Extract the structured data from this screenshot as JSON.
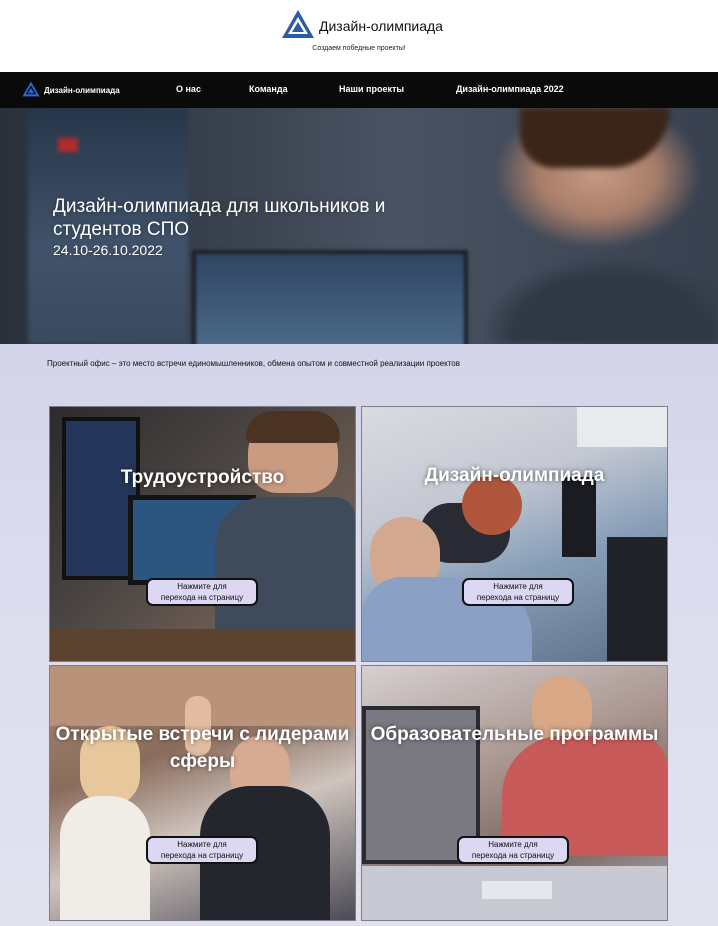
{
  "header": {
    "brand_title": "Дизайн-олимпиада",
    "tagline": "Создаем победные проекты!"
  },
  "nav": {
    "logo_label": "Дизайн-олимпиада",
    "links": [
      "О нас",
      "Команда",
      "Наши проекты",
      "Дизайн-олимпиада 2022"
    ]
  },
  "hero": {
    "title": "Дизайн-олимпиада для школьников и студентов СПО",
    "dates": "24.10-26.10.2022"
  },
  "intro": {
    "text": "Проектный офис – это место встречи единомышленников, обмена опытом и совместной реализации проектов"
  },
  "cards": [
    {
      "title": "Трудоустройство",
      "button_line1": "Нажмите для",
      "button_line2": "перехода на страницу"
    },
    {
      "title": "Дизайн-олимпиада",
      "button_line1": "Нажмите для",
      "button_line2": "перехода на страницу"
    },
    {
      "title": "Открытые встречи с лидерами сферы",
      "button_line1": "Нажмите для",
      "button_line2": "перехода на страницу"
    },
    {
      "title": "Образовательные программы",
      "button_line1": "Нажмите для",
      "button_line2": "перехода на страницу"
    }
  ],
  "colors": {
    "nav_bg": "#0a0a0a",
    "logo_blue": "#2a5aa8",
    "button_bg": "#dcd7f2",
    "page_bg": "#dcdcec"
  },
  "icons": {
    "logo": "triangle-logo-icon"
  }
}
